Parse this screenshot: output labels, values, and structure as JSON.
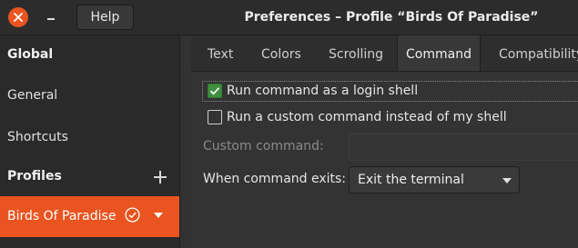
{
  "header": {
    "help_label": "Help",
    "title": "Preferences – Profile “Birds Of Paradise”",
    "close_icon": "close-icon",
    "minimize_icon": "minimize-icon"
  },
  "sidebar": {
    "global_heading": "Global",
    "items": [
      {
        "label": "General"
      },
      {
        "label": "Shortcuts"
      }
    ],
    "profiles_heading": "Profiles",
    "add_icon": "plus-icon",
    "profiles": [
      {
        "label": "Birds Of Paradise",
        "is_default": true
      }
    ]
  },
  "tabs": [
    {
      "label": "Text"
    },
    {
      "label": "Colors"
    },
    {
      "label": "Scrolling"
    },
    {
      "label": "Command",
      "active": true
    },
    {
      "label": "Compatibility"
    }
  ],
  "command": {
    "login_shell_label": "Run command as a login shell",
    "login_shell_checked": true,
    "custom_command_label": "Run a custom command instead of my shell",
    "custom_command_checked": false,
    "custom_field_label": "Custom command:",
    "custom_field_value": "",
    "exit_label": "When command exits:",
    "exit_value": "Exit the terminal"
  },
  "colors": {
    "accent": "#e95420",
    "checkbox_on": "#3e8e3e",
    "background": "#333333",
    "sidebar": "#2a2a2a"
  }
}
